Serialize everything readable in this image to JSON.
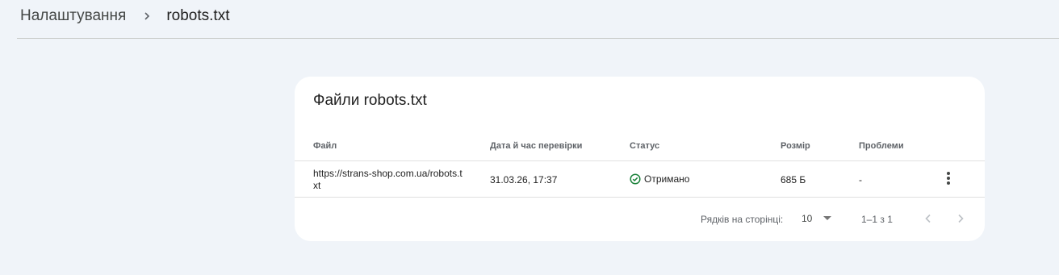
{
  "breadcrumb": {
    "parent": "Налаштування",
    "current": "robots.txt"
  },
  "card": {
    "title": "Файли robots.txt",
    "columns": {
      "file": "Файл",
      "date": "Дата й час перевірки",
      "status": "Статус",
      "size": "Розмір",
      "problems": "Проблеми"
    },
    "rows": [
      {
        "file": "https://strans-shop.com.ua/robots.txt",
        "date": "31.03.26, 17:37",
        "status": "Отримано",
        "size": "685 Б",
        "problems": "-"
      }
    ],
    "pagination": {
      "rows_per_page_label": "Рядків на сторінці:",
      "rows_per_page_value": "10",
      "range": "1–1 з 1"
    }
  },
  "colors": {
    "background": "#f0f4f9",
    "card": "#ffffff",
    "status_ok": "#188038"
  },
  "icons": [
    "chevron-right-icon",
    "check-circle-icon",
    "more-vert-icon",
    "dropdown-arrow-icon",
    "chevron-left-icon"
  ]
}
